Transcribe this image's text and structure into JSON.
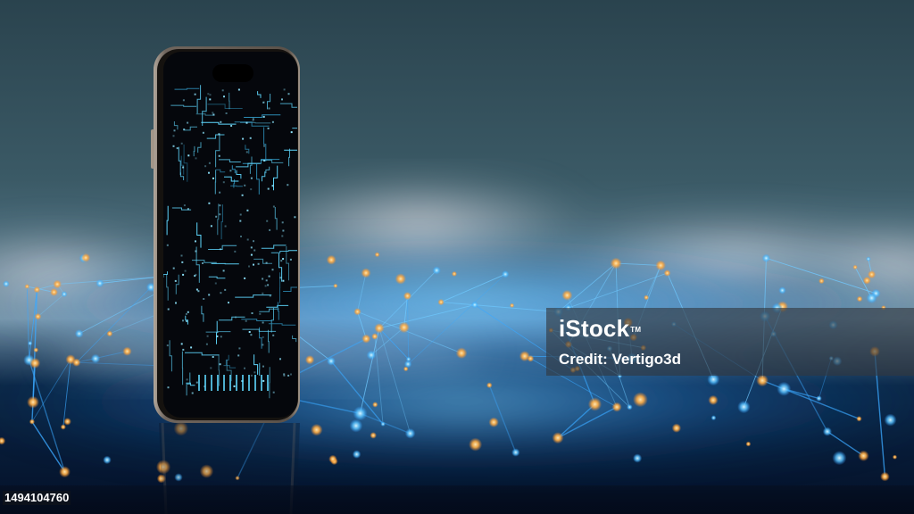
{
  "image": {
    "watermark": {
      "brand": "iStock",
      "trademark": "TM",
      "credit": "Credit: Vertigo3d"
    },
    "stock_id": "1494104760"
  },
  "colors": {
    "sky_top": "#2c4752",
    "sky_mid": "#4d6c78",
    "haze": "#cfd6e0",
    "network_blue": "#3fb6ff",
    "node_orange": "#ffb24a",
    "phone_frame": "#8c7f74",
    "phone_screen": "#05070c",
    "circuit_cyan": "#5fd8ff"
  }
}
